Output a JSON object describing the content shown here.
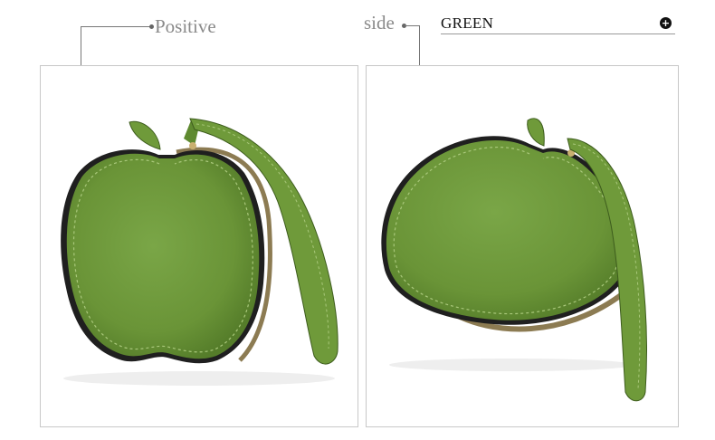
{
  "labels": {
    "view_front": "Positive",
    "view_side": "side"
  },
  "color_selector": {
    "label": "GREEN",
    "icon": "plus-circle-icon"
  },
  "photos": [
    {
      "view": "front",
      "subject": "apple-shaped-coin-purse",
      "color": "#6f9a3a"
    },
    {
      "view": "side",
      "subject": "apple-shaped-coin-purse",
      "color": "#6f9a3a"
    }
  ],
  "colors": {
    "leather": "#6f9a3a",
    "leather_dark": "#4f7526",
    "edge": "#1f1f1f",
    "frame_border": "#c8c8c8"
  }
}
